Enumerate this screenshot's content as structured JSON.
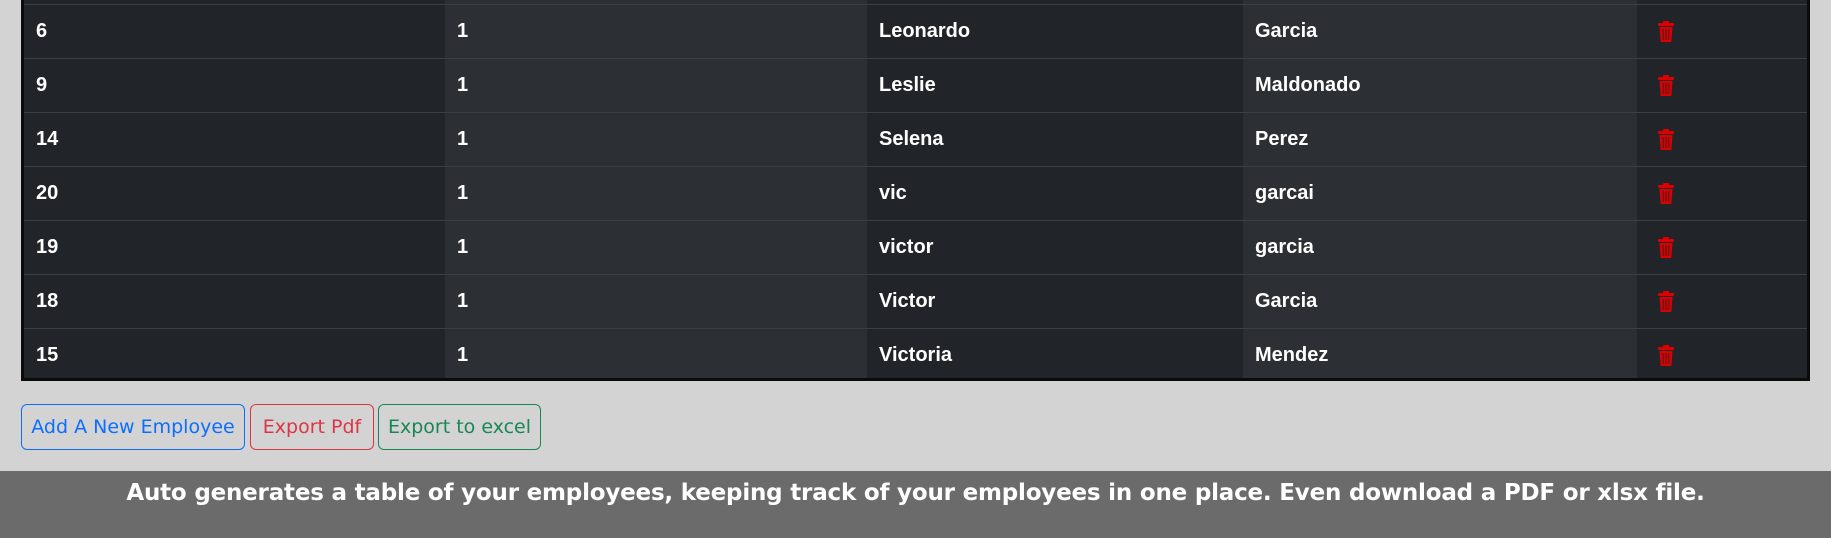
{
  "table": {
    "rows": [
      {
        "id": "6",
        "num": "1",
        "first": "Leonardo",
        "last": "Garcia"
      },
      {
        "id": "9",
        "num": "1",
        "first": "Leslie",
        "last": "Maldonado"
      },
      {
        "id": "14",
        "num": "1",
        "first": "Selena",
        "last": "Perez"
      },
      {
        "id": "20",
        "num": "1",
        "first": "vic",
        "last": "garcai"
      },
      {
        "id": "19",
        "num": "1",
        "first": "victor",
        "last": "garcia"
      },
      {
        "id": "18",
        "num": "1",
        "first": "Victor",
        "last": "Garcia"
      },
      {
        "id": "15",
        "num": "1",
        "first": "Victoria",
        "last": "Mendez"
      }
    ],
    "delete_icon": "trash-icon",
    "delete_color": "#dc0000"
  },
  "actions": {
    "add_label": "Add A New Employee",
    "pdf_label": "Export Pdf",
    "excel_label": "Export to excel"
  },
  "footer": {
    "text": "Auto generates a table of your employees, keeping track of your employees in one place. Even download a PDF or xlsx file."
  },
  "colors": {
    "primary": "#0d6efd",
    "danger": "#dc3545",
    "success": "#198754",
    "table_bg": "#212529",
    "page_bg": "#d3d3d3",
    "footer_bg": "#6b6b6b"
  }
}
